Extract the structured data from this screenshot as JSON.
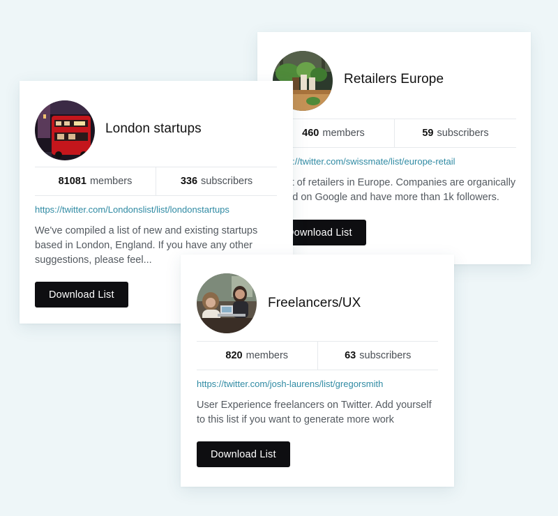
{
  "cards": [
    {
      "title": "Retailers Europe",
      "members_count": "460",
      "members_label": "members",
      "subscribers_count": "59",
      "subscribers_label": "subscribers",
      "link": "https://twitter.com/swissmate/list/europe-retail",
      "description": "A list of retailers in Europe. Companies are organically found on Google and have more than 1k followers.",
      "button_label": "Download List",
      "avatar_icon": "plants-shelf-photo"
    },
    {
      "title": "London startups",
      "members_count": "81081",
      "members_label": "members",
      "subscribers_count": "336",
      "subscribers_label": "subscribers",
      "link": "https://twitter.com/Londonslist/list/londonstartups",
      "description": "We've compiled a list of new and existing startups based in London, England. If you have any other suggestions, please feel...",
      "button_label": "Download List",
      "avatar_icon": "london-red-bus-photo"
    },
    {
      "title": "Freelancers/UX",
      "members_count": "820",
      "members_label": "members",
      "subscribers_count": "63",
      "subscribers_label": "subscribers",
      "link": "https://twitter.com/josh-laurens/list/gregorsmith",
      "description": "User Experience freelancers on Twitter. Add yourself to this list if you want to generate more work",
      "button_label": "Download List",
      "avatar_icon": "freelancers-laptop-photo"
    }
  ]
}
